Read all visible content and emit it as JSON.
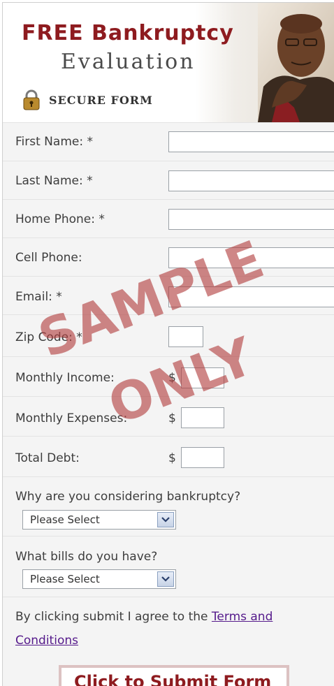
{
  "header": {
    "title": "FREE Bankruptcy",
    "subtitle": "Evaluation",
    "secure_label": "SECURE FORM"
  },
  "fields": {
    "first_name": {
      "label": "First Name: *",
      "value": ""
    },
    "last_name": {
      "label": "Last Name: *",
      "value": ""
    },
    "home_phone": {
      "label": "Home Phone: *",
      "value": ""
    },
    "cell_phone": {
      "label": "Cell Phone:",
      "value": ""
    },
    "email": {
      "label": "Email: *",
      "value": ""
    },
    "zip_code": {
      "label": "Zip Code: *",
      "value": ""
    },
    "monthly_income": {
      "label": "Monthly Income:",
      "currency": "$",
      "value": ""
    },
    "monthly_expenses": {
      "label": "Monthly Expenses:",
      "currency": "$",
      "value": ""
    },
    "total_debt": {
      "label": "Total Debt:",
      "currency": "$",
      "value": ""
    }
  },
  "questions": {
    "why_bankruptcy": {
      "label": "Why are you considering bankruptcy?",
      "selected": "Please Select"
    },
    "bills": {
      "label": "What bills do you have?",
      "selected": "Please Select"
    }
  },
  "agreement": {
    "text": "By clicking submit I agree to the ",
    "link": "Terms and Conditions"
  },
  "submit_label": "Click to Submit Form",
  "watermark": {
    "line1": "SAMPLE",
    "line2": "ONLY"
  },
  "colors": {
    "brand_red": "#8e1b1f",
    "watermark": "#b23e3e",
    "link": "#551a8b"
  }
}
